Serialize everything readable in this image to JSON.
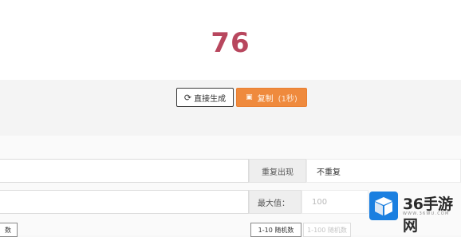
{
  "result": {
    "value": "76"
  },
  "actions": {
    "regenerate_label": "直接生成",
    "copy_label": "复制",
    "copy_hint": "(1秒)"
  },
  "settings": {
    "repeat_label": "重复出现",
    "repeat_value": "不重复",
    "max_label": "最大值：",
    "max_value": "100"
  },
  "presets": {
    "left_button": "数",
    "range_10": "1-10 随机数",
    "range_100": "1-100 随机数"
  },
  "watermark": {
    "brand": "36手游网",
    "url": "WWW.36WU.COM"
  }
}
